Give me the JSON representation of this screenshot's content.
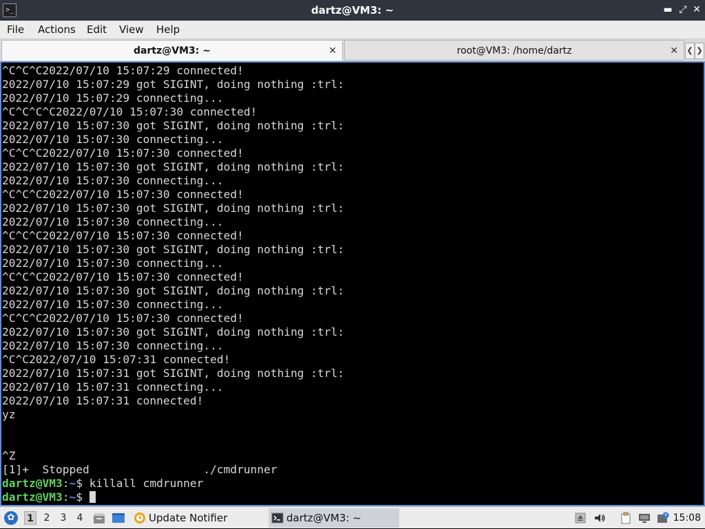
{
  "window": {
    "title": "dartz@VM3: ~",
    "controls": [
      "minimize",
      "maximize",
      "close"
    ]
  },
  "menu": [
    "File",
    "Actions",
    "Edit",
    "View",
    "Help"
  ],
  "tabs": [
    {
      "label": "dartz@VM3: ~",
      "active": true
    },
    {
      "label": "root@VM3: /home/dartz",
      "active": false
    }
  ],
  "terminal": {
    "lines": [
      "^C^C^C2022/07/10 15:07:29 connected!",
      "2022/07/10 15:07:29 got SIGINT, doing nothing :trl:",
      "2022/07/10 15:07:29 connecting...",
      "^C^C^C^C2022/07/10 15:07:30 connected!",
      "2022/07/10 15:07:30 got SIGINT, doing nothing :trl:",
      "2022/07/10 15:07:30 connecting...",
      "^C^C^C2022/07/10 15:07:30 connected!",
      "2022/07/10 15:07:30 got SIGINT, doing nothing :trl:",
      "2022/07/10 15:07:30 connecting...",
      "^C^C^C2022/07/10 15:07:30 connected!",
      "2022/07/10 15:07:30 got SIGINT, doing nothing :trl:",
      "2022/07/10 15:07:30 connecting...",
      "^C^C^C2022/07/10 15:07:30 connected!",
      "2022/07/10 15:07:30 got SIGINT, doing nothing :trl:",
      "2022/07/10 15:07:30 connecting...",
      "^C^C^C2022/07/10 15:07:30 connected!",
      "2022/07/10 15:07:30 got SIGINT, doing nothing :trl:",
      "2022/07/10 15:07:30 connecting...",
      "^C^C^C2022/07/10 15:07:30 connected!",
      "2022/07/10 15:07:30 got SIGINT, doing nothing :trl:",
      "2022/07/10 15:07:30 connecting...",
      "^C^C2022/07/10 15:07:31 connected!",
      "2022/07/10 15:07:31 got SIGINT, doing nothing :trl:",
      "2022/07/10 15:07:31 connecting...",
      "2022/07/10 15:07:31 connected!",
      "yz",
      "",
      "",
      "^Z",
      "[1]+  Stopped                 ./cmdrunner"
    ],
    "prompts": [
      {
        "user": "dartz@VM3",
        "sep": ":",
        "path": "~",
        "symbol": "$ ",
        "command": "killall cmdrunner"
      },
      {
        "user": "dartz@VM3",
        "sep": ":",
        "path": "~",
        "symbol": "$ ",
        "command": ""
      }
    ],
    "colors": {
      "background": "#000000",
      "text": "#d8d8d8",
      "prompt_user": "#5fd35f",
      "prompt_path": "#6e7cff",
      "border": "#5b8fd8"
    }
  },
  "taskbar": {
    "workspaces": [
      "1",
      "2",
      "3",
      "4"
    ],
    "active_workspace": "1",
    "tasks": [
      {
        "label": "Update Notifier",
        "icon": "update-notifier-icon",
        "active": false
      },
      {
        "label": "dartz@VM3: ~",
        "icon": "terminal-icon",
        "active": true
      }
    ],
    "tray_icons": [
      "eject-icon",
      "volume-icon",
      "clipboard-icon",
      "network-icon",
      "notification-icon"
    ],
    "clock": "15:08"
  }
}
